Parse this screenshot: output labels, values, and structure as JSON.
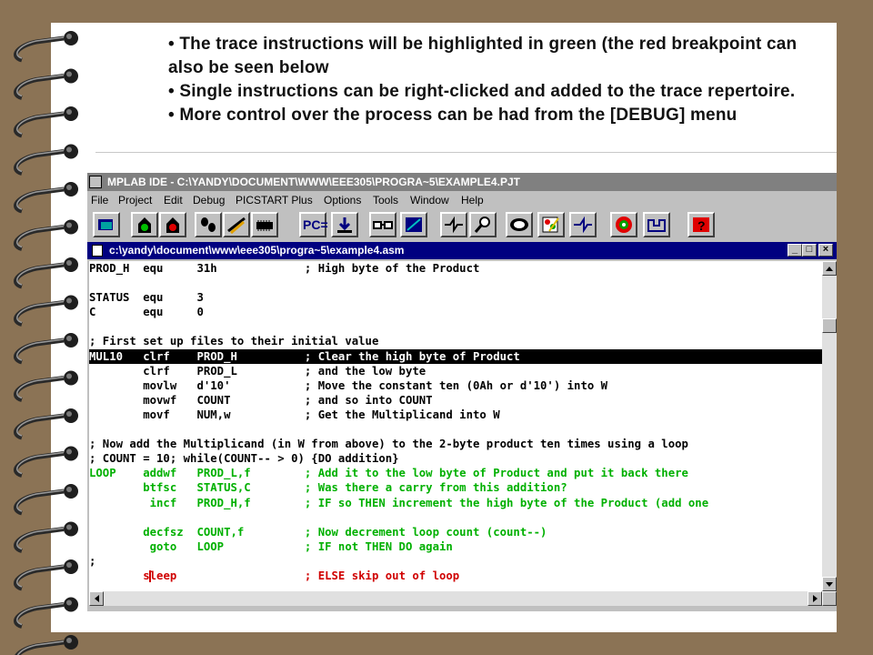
{
  "slide": {
    "bullets": [
      "• The trace instructions will be highlighted in green (the red breakpoint can also be seen below",
      "• Single instructions can be right-clicked and added to the trace repertoire.",
      "• More control over the process can be had from the [DEBUG] menu"
    ]
  },
  "window": {
    "title": "MPLAB IDE - C:\\YANDY\\DOCUMENT\\WWW\\EEE305\\PROGRA~5\\EXAMPLE4.PJT"
  },
  "menu": [
    "File",
    "Project",
    "Edit",
    "Debug",
    "PICSTART Plus",
    "Options",
    "Tools",
    "Window",
    "Help"
  ],
  "toolbar": {
    "buttons": [
      "project-icon",
      "stoplight-run-icon",
      "stoplight-halt-icon",
      "step-footprints-icon",
      "step-over-icon",
      "chip-icon",
      "pc-button",
      "download-icon",
      "glasses-watch-icon",
      "stack-icon",
      "trace-icon",
      "magnifier-icon",
      "window-icon",
      "palette-icon",
      "branch-icon",
      "pic-logo-icon",
      "mplab-icon",
      "help-icon"
    ],
    "pc_label": "PC="
  },
  "editor": {
    "title": "c:\\yandy\\document\\www\\eee305\\progra~5\\example4.asm",
    "lines": [
      {
        "text": "PROD_H  equ     31h             ; High byte of the Product",
        "style": "normal"
      },
      {
        "text": "",
        "style": "normal"
      },
      {
        "text": "STATUS  equ     3",
        "style": "normal"
      },
      {
        "text": "C       equ     0",
        "style": "normal"
      },
      {
        "text": "",
        "style": "normal"
      },
      {
        "text": "; First set up files to their initial value",
        "style": "normal"
      },
      {
        "text": "MUL10   clrf    PROD_H          ; Clear the high byte of Product",
        "style": "selected"
      },
      {
        "text": "        clrf    PROD_L          ; and the low byte",
        "style": "normal"
      },
      {
        "text": "        movlw   d'10'           ; Move the constant ten (0Ah or d'10') into W",
        "style": "normal"
      },
      {
        "text": "        movwf   COUNT           ; and so into COUNT",
        "style": "normal"
      },
      {
        "text": "        movf    NUM,w           ; Get the Multiplicand into W",
        "style": "normal"
      },
      {
        "text": "",
        "style": "normal"
      },
      {
        "text": "; Now add the Multiplicand (in W from above) to the 2-byte product ten times using a loop",
        "style": "normal"
      },
      {
        "text": "; COUNT = 10; while(COUNT-- > 0) {DO addition}",
        "style": "normal"
      },
      {
        "text": "LOOP    addwf   PROD_L,f        ; Add it to the low byte of Product and put it back there",
        "style": "trace"
      },
      {
        "text": "        btfsc   STATUS,C        ; Was there a carry from this addition?",
        "style": "trace"
      },
      {
        "text": "         incf   PROD_H,f        ; IF so THEN increment the high byte of the Product (add one",
        "style": "trace"
      },
      {
        "text": "",
        "style": "normal"
      },
      {
        "text": "        decfsz  COUNT,f         ; Now decrement loop count (count--)",
        "style": "trace"
      },
      {
        "text": "         goto   LOOP            ; IF not THEN DO again",
        "style": "trace"
      },
      {
        "text": ";",
        "style": "normal"
      },
      {
        "text": "        sleep                   ; ELSE skip out of loop",
        "style": "breakpoint"
      }
    ]
  },
  "colors": {
    "trace": "#00b000",
    "breakpoint": "#d00000",
    "selection": "#000000",
    "title_active": "#000080",
    "title_inactive": "#808080"
  }
}
